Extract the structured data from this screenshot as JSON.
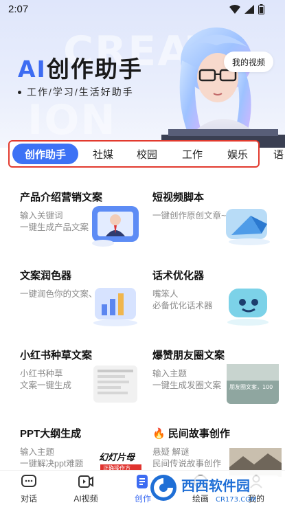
{
  "status_bar": {
    "time": "2:07"
  },
  "header": {
    "title_ai": "AI",
    "title_rest": "创作助手",
    "subtitle": "工作/学习/生活好助手",
    "bg_word_1": "CREAT",
    "bg_word_2": "ION",
    "my_video_label": "我的视频"
  },
  "tabs": [
    "创作助手",
    "社媒",
    "校园",
    "工作",
    "娱乐",
    "语"
  ],
  "active_tab": "创作助手",
  "cards": [
    {
      "title": "产品介绍营销文案",
      "desc": [
        "输入关键词",
        "一键生成产品文案"
      ]
    },
    {
      "title": "短视频脚本",
      "desc": [
        "一键创作原创文章~"
      ]
    },
    {
      "title": "文案润色器",
      "desc": [
        "一键润色你的文案、文章"
      ]
    },
    {
      "title": "话术优化器",
      "desc": [
        "嘴笨人",
        "必备优化话术器"
      ]
    },
    {
      "title": "小红书种草文案",
      "desc": [
        "小红书种草",
        "文案一键生成"
      ]
    },
    {
      "title": "爆赞朋友圈文案",
      "desc": [
        "输入主题",
        "一键生成发圈文案"
      ]
    },
    {
      "title": "PPT大纲生成",
      "desc": [
        "输入主题",
        "一键解决ppt难题"
      ]
    },
    {
      "title": "民间故事创作",
      "desc": [
        "悬疑 解谜",
        "民间传说故事创作"
      ]
    }
  ],
  "illus_text": {
    "ppt": "幻灯片母",
    "ppt_sub": "正确操作方",
    "moments": "朋友圈文案，100"
  },
  "bottom_nav": [
    {
      "label": "对话",
      "icon": "chat-icon"
    },
    {
      "label": "AI视频",
      "icon": "video-icon"
    },
    {
      "label": "创作",
      "icon": "create-icon"
    },
    {
      "label": "绘画",
      "icon": "paint-icon"
    },
    {
      "label": "我的",
      "icon": "profile-icon"
    }
  ],
  "active_nav": "创作",
  "watermark": {
    "brand": "西西软件园",
    "url": "CR173.COM"
  },
  "colors": {
    "accent": "#3d6cf2",
    "tab_highlight_border": "#e23a2e"
  }
}
